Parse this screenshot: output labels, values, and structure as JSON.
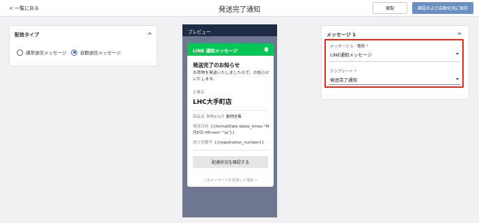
{
  "header": {
    "back_label": "< 一覧に戻る",
    "title": "発送完了通知",
    "copy_label": "複製",
    "save_label": "確認および自動化用に保存"
  },
  "delivery": {
    "title": "配信タイプ",
    "options": [
      "通常送信メッセージ",
      "自動送信メッセージ"
    ],
    "selected": "自動送信メッセージ"
  },
  "preview": {
    "label": "プレビュー",
    "line_title": "LINE 通知メッセージ",
    "heading": "発送完了のお知らせ",
    "body": "お荷物を発送いたしましたので、お知らせいたします。",
    "company_label": "企業名",
    "company": "LHC大手町店",
    "rows": [
      {
        "key": "商品名",
        "value": "かわいい！動物全集"
      },
      {
        "key": "発送日時",
        "value": "{{formatDate dates_times \"M月D日 HH:mm\" \"ja\"}}"
      },
      {
        "key": "送り状番号",
        "value": "{{registration_number}}"
      }
    ],
    "button_label": "配達状況を確認する",
    "reason_link": "このメッセージを受信した理由 >"
  },
  "message": {
    "title": "メッセージ 1",
    "type_label": "メッセージ 1 - 種類 *",
    "type_value": "LINE通知メッセージ",
    "template_label": "テンプレート *",
    "template_value": "発送完了通知"
  },
  "colors": {
    "accent": "#6c8fc2",
    "line_green": "#06c755",
    "highlight": "#e3261f",
    "preview_bg": "#6e7690",
    "preview_header": "#1f2c45"
  }
}
